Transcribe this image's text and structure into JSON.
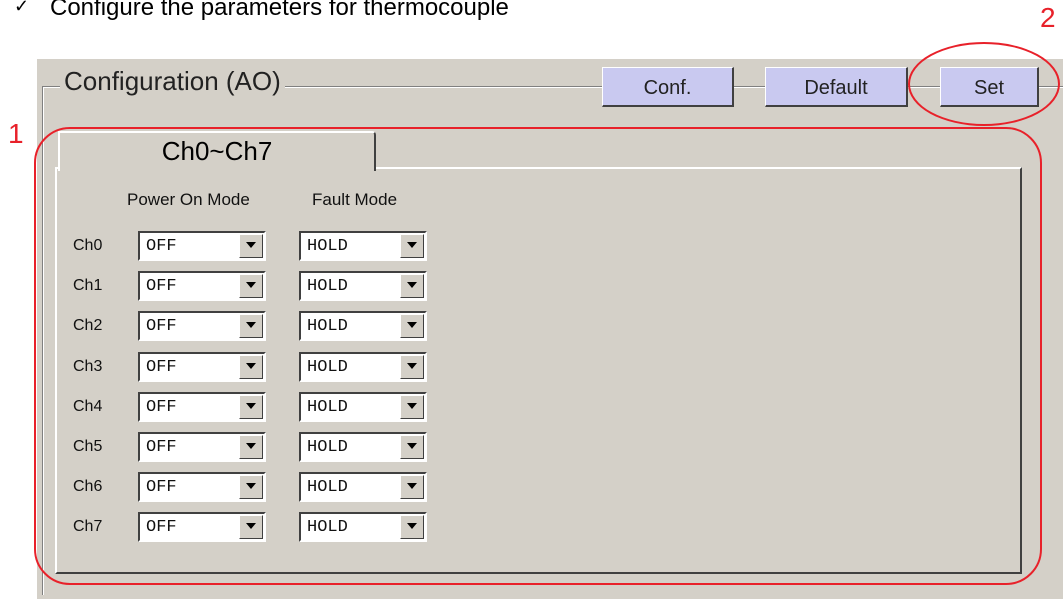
{
  "caption": {
    "bullet": "✓",
    "text": "Configure the parameters for thermocouple"
  },
  "group": {
    "title": "Configuration (AO)"
  },
  "buttons": {
    "conf": "Conf.",
    "default": "Default",
    "set": "Set"
  },
  "tab": {
    "label": "Ch0~Ch7"
  },
  "columns": {
    "power_on": "Power On Mode",
    "fault": "Fault Mode"
  },
  "channels": [
    {
      "label": "Ch0",
      "power_on": "OFF",
      "fault": "HOLD"
    },
    {
      "label": "Ch1",
      "power_on": "OFF",
      "fault": "HOLD"
    },
    {
      "label": "Ch2",
      "power_on": "OFF",
      "fault": "HOLD"
    },
    {
      "label": "Ch3",
      "power_on": "OFF",
      "fault": "HOLD"
    },
    {
      "label": "Ch4",
      "power_on": "OFF",
      "fault": "HOLD"
    },
    {
      "label": "Ch5",
      "power_on": "OFF",
      "fault": "HOLD"
    },
    {
      "label": "Ch6",
      "power_on": "OFF",
      "fault": "HOLD"
    },
    {
      "label": "Ch7",
      "power_on": "OFF",
      "fault": "HOLD"
    }
  ],
  "annotations": {
    "marker1": "1",
    "marker2": "2",
    "color": "#e8212a"
  },
  "icons": {
    "dropdown": "triangle-down-icon",
    "check": "check-icon"
  }
}
